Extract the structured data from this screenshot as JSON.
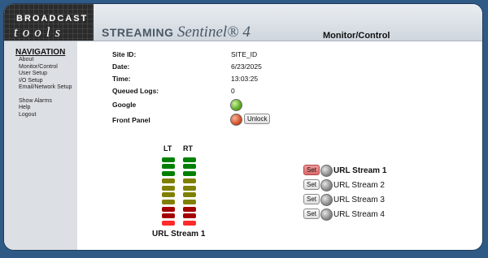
{
  "header": {
    "logo_top": "BROADCAST",
    "logo_bottom": "tools",
    "product_brand": "STREAMING",
    "product_name": "Sentinel® 4",
    "page_heading": "Monitor/Control"
  },
  "sidebar": {
    "title": "NAVIGATION",
    "items": [
      "About",
      "Monitor/Control",
      "User Setup",
      "I/O Setup",
      "Email/Network Setup"
    ],
    "items2": [
      "Show Alarms",
      "Help",
      "Logout"
    ]
  },
  "status": {
    "site_id_label": "Site ID:",
    "site_id_value": "SITE_ID",
    "date_label": "Date:",
    "date_value": "6/23/2025",
    "time_label": "Time:",
    "time_value": "13:03:25",
    "queued_logs_label": "Queued Logs:",
    "queued_logs_value": "0",
    "google_label": "Google",
    "google_led": "green",
    "front_panel_label": "Front Panel",
    "front_panel_led": "red",
    "unlock_label": "Unlock"
  },
  "meters": {
    "left_label": "LT",
    "right_label": "RT",
    "caption": "URL Stream 1",
    "segment_colors": [
      "#ff2a2a",
      "#a30000",
      "#a30000",
      "#808000",
      "#808000",
      "#808000",
      "#808000",
      "#008000",
      "#008000",
      "#008000"
    ]
  },
  "streams": {
    "set_label": "Set",
    "items": [
      {
        "name": "URL Stream 1",
        "selected": true
      },
      {
        "name": "URL Stream 2",
        "selected": false
      },
      {
        "name": "URL Stream 3",
        "selected": false
      },
      {
        "name": "URL Stream 4",
        "selected": false
      }
    ]
  }
}
